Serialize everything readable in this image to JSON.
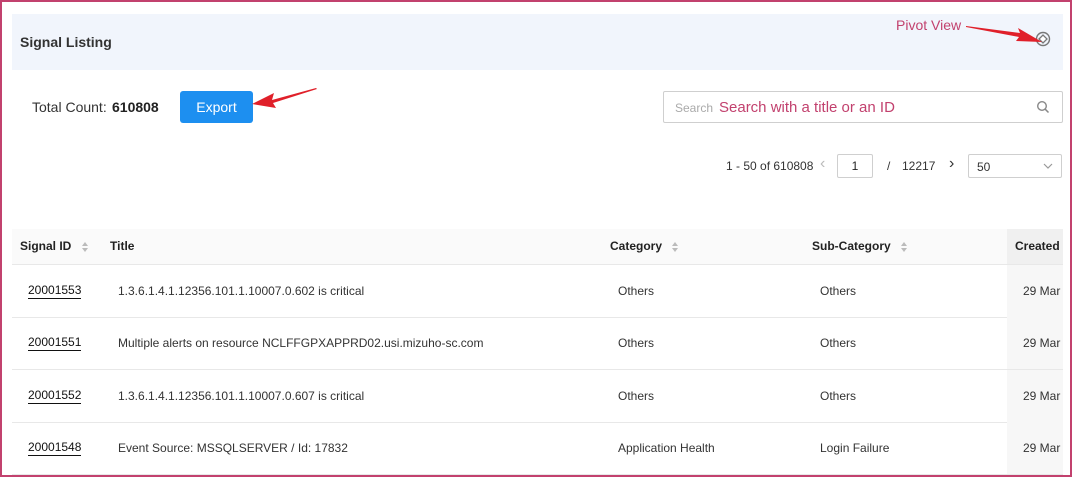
{
  "header": {
    "title": "Signal Listing",
    "pivot_annotation": "Pivot View"
  },
  "toolbar": {
    "total_label": "Total Count:",
    "total_value": "610808",
    "export_label": "Export"
  },
  "search": {
    "placeholder": "Search",
    "hint_annotation": "Search with a title or an ID"
  },
  "pager": {
    "range": "1 - 50 of 610808",
    "current_page": "1",
    "separator": "/",
    "total_pages": "12217",
    "page_size": "50"
  },
  "table": {
    "columns": [
      "Signal ID",
      "Title",
      "Category",
      "Sub-Category",
      "Created"
    ],
    "rows": [
      {
        "id": "20001553",
        "title": "1.3.6.1.4.1.12356.101.1.10007.0.602 is critical",
        "category": "Others",
        "sub_category": "Others",
        "created": "29 Mar"
      },
      {
        "id": "20001551",
        "title": "Multiple alerts on resource NCLFFGPXAPPRD02.usi.mizuho-sc.com",
        "category": "Others",
        "sub_category": "Others",
        "created": "29 Mar"
      },
      {
        "id": "20001552",
        "title": "1.3.6.1.4.1.12356.101.1.10007.0.607 is critical",
        "category": "Others",
        "sub_category": "Others",
        "created": "29 Mar"
      },
      {
        "id": "20001548",
        "title": "Event Source: MSSQLSERVER / Id: 17832",
        "category": "Application Health",
        "sub_category": "Login Failure",
        "created": "29 Mar"
      }
    ]
  },
  "icons": {
    "pivot": "pivot-view-icon",
    "search": "search-icon",
    "sort": "sort-icon",
    "chevron": "chevron-down-icon"
  },
  "colors": {
    "accent": "#1d8ff0",
    "annotation": "#c2416e",
    "header_bg": "#f1f5fc"
  }
}
